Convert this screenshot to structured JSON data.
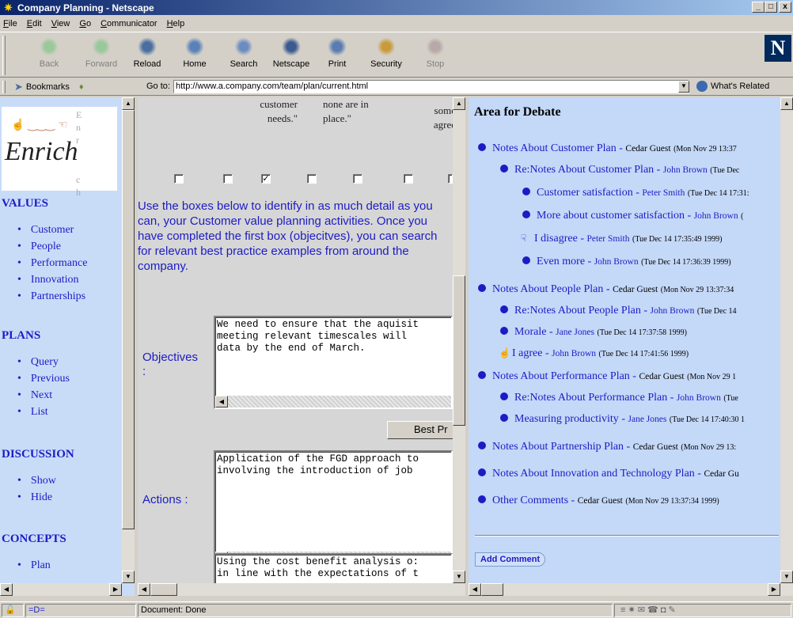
{
  "window": {
    "title": "Company Planning - Netscape",
    "min": "_",
    "max": "□",
    "close": "x"
  },
  "menu": [
    "File",
    "Edit",
    "View",
    "Go",
    "Communicator",
    "Help"
  ],
  "toolbar": [
    {
      "label": "Back",
      "icon": "back-arrow-icon",
      "enabled": false
    },
    {
      "label": "Forward",
      "icon": "forward-arrow-icon",
      "enabled": false
    },
    {
      "label": "Reload",
      "icon": "reload-icon",
      "enabled": true
    },
    {
      "label": "Home",
      "icon": "home-icon",
      "enabled": true
    },
    {
      "label": "Search",
      "icon": "search-icon",
      "enabled": true
    },
    {
      "label": "Netscape",
      "icon": "my-netscape-icon",
      "enabled": true
    },
    {
      "label": "Print",
      "icon": "print-icon",
      "enabled": true
    },
    {
      "label": "Security",
      "icon": "lock-icon",
      "enabled": true
    },
    {
      "label": "Stop",
      "icon": "stop-icon",
      "enabled": false
    }
  ],
  "location": {
    "bookmarks": "Bookmarks",
    "goto": "Go to:",
    "url": "http://www.a.company.com/team/plan/current.html",
    "related": "What's Related"
  },
  "left": {
    "logo": {
      "word": "Enrich",
      "vertical": [
        "E",
        "n",
        "r",
        "i",
        "c",
        "h"
      ]
    },
    "sections": [
      {
        "title": "VALUES",
        "items": [
          "Customer",
          "People",
          "Performance",
          "Innovation",
          "Partnerships"
        ]
      },
      {
        "title": "PLANS",
        "items": [
          "Query",
          "Previous",
          "Next",
          "List"
        ]
      },
      {
        "title": "DISCUSSION",
        "items": [
          "Show",
          "Hide"
        ]
      },
      {
        "title": "CONCEPTS",
        "items": [
          "Plan"
        ]
      }
    ]
  },
  "middle": {
    "columns": [
      {
        "text": "customer\nneeds.\""
      },
      {
        "text": "none are in\nplace.\""
      },
      {
        "text": "some\nagree"
      }
    ],
    "checkboxes": [
      false,
      false,
      true,
      false,
      false,
      false,
      false
    ],
    "instructions": "Use the boxes below to identify in as much detail as you can, your Customer value planning activities. Once you have completed the first box (objecitves), you can search for relevant best practice examples from around the company.",
    "objectives_label": "Objectives\n:",
    "objectives_text": "We need to ensure that the aquisit\nmeeting relevant timescales will \ndata by the end of March.",
    "best_button": "Best Pr",
    "actions_label": "Actions :",
    "actions_text": "Application of the FGD approach to\ninvolving the introduction of job",
    "third_text": "Using the cost benefit analysis o:\nin line with the expectations of t"
  },
  "right": {
    "title": "Area for Debate",
    "posts": [
      {
        "level": 0,
        "bullet": "dot",
        "title": "Notes About Customer Plan",
        "author": "Cedar Guest",
        "author_link": false,
        "ts": "(Mon Nov 29 13:37"
      },
      {
        "level": 1,
        "bullet": "dot",
        "title": "Re:Notes About Customer Plan",
        "author": "John Brown",
        "author_link": true,
        "ts": "(Tue Dec"
      },
      {
        "level": 2,
        "bullet": "dot",
        "title": "Customer satisfaction",
        "author": "Peter Smith",
        "author_link": true,
        "ts": "(Tue Dec 14 17:31:"
      },
      {
        "level": 2,
        "bullet": "dot",
        "title": "More about customer satisfaction",
        "author": "John Brown",
        "author_link": true,
        "ts": "("
      },
      {
        "level": 2,
        "bullet": "thumbs-down",
        "title": "I disagree",
        "author": "Peter Smith",
        "author_link": true,
        "ts": "(Tue Dec 14 17:35:49 1999)"
      },
      {
        "level": 2,
        "bullet": "dot",
        "title": "Even more",
        "author": "John Brown",
        "author_link": true,
        "ts": "(Tue Dec 14 17:36:39 1999)"
      },
      {
        "level": 0,
        "bullet": "dot",
        "title": "Notes About People Plan",
        "author": "Cedar Guest",
        "author_link": false,
        "ts": "(Mon Nov 29 13:37:34"
      },
      {
        "level": 1,
        "bullet": "dot",
        "title": "Re:Notes About People Plan",
        "author": "John Brown",
        "author_link": true,
        "ts": "(Tue Dec 14"
      },
      {
        "level": 1,
        "bullet": "dot",
        "title": "Morale",
        "author": "Jane Jones",
        "author_link": true,
        "ts": "(Tue Dec 14 17:37:58 1999)"
      },
      {
        "level": 1,
        "bullet": "thumbs-up",
        "title": "I agree",
        "author": "John Brown",
        "author_link": true,
        "ts": "(Tue Dec 14 17:41:56 1999)"
      },
      {
        "level": 0,
        "bullet": "dot",
        "title": "Notes About Performance Plan",
        "author": "Cedar Guest",
        "author_link": false,
        "ts": "(Mon Nov 29 1"
      },
      {
        "level": 1,
        "bullet": "dot",
        "title": "Re:Notes About Performance Plan",
        "author": "John Brown",
        "author_link": true,
        "ts": "(Tue"
      },
      {
        "level": 1,
        "bullet": "dot",
        "title": "Measuring productivity",
        "author": "Jane Jones",
        "author_link": true,
        "ts": "(Tue Dec 14 17:40:30 1"
      },
      {
        "level": 0,
        "bullet": "dot",
        "title": "Notes About Partnership Plan",
        "author": "Cedar Guest",
        "author_link": false,
        "ts": "(Mon Nov 29 13:"
      },
      {
        "level": 0,
        "bullet": "dot",
        "title": "Notes About Innovation and Technology Plan",
        "author": "Cedar Gu",
        "author_link": false,
        "ts": ""
      },
      {
        "level": 0,
        "bullet": "dot",
        "title": "Other Comments",
        "author": "Cedar Guest",
        "author_link": false,
        "ts": "(Mon Nov 29 13:37:34 1999)"
      }
    ],
    "add_comment": "Add Comment"
  },
  "status": {
    "text": "Document: Done"
  }
}
